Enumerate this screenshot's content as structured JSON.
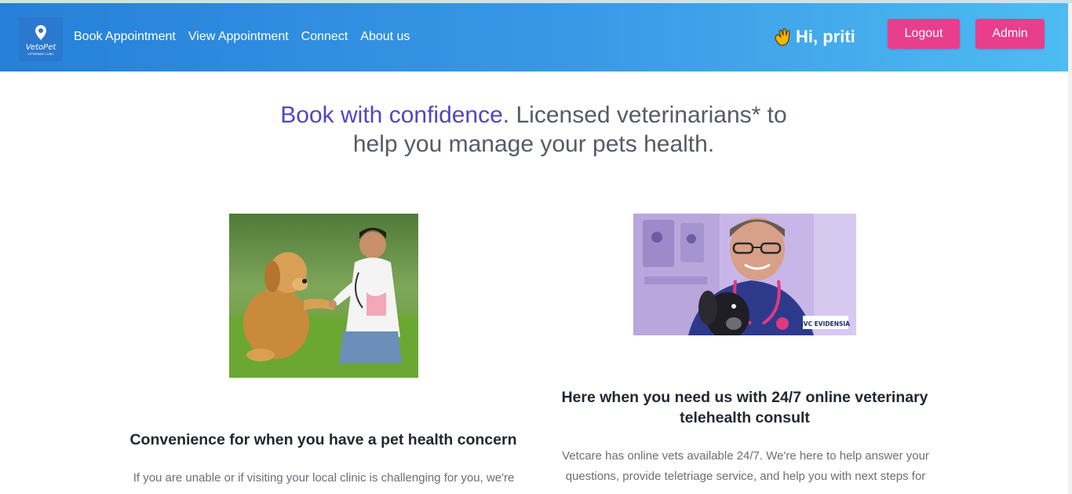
{
  "nav": {
    "logo_text": "VetoPet",
    "logo_subtext": "VETERINARY CLINIC",
    "links": [
      {
        "label": "Book Appointment"
      },
      {
        "label": "View Appointment"
      },
      {
        "label": "Connect"
      },
      {
        "label": "About us"
      }
    ],
    "greeting": "Hi, priti",
    "logout_label": "Logout",
    "admin_label": "Admin"
  },
  "hero": {
    "emphasis": "Book with confidence.",
    "rest": " Licensed veterinarians* to help you manage your pets health."
  },
  "cards": [
    {
      "title": "Convenience for when you have a pet health concern",
      "text": "If you are unable or if visiting your local clinic is challenging for you, we're"
    },
    {
      "title": "Here when you need us with 24/7 online veterinary telehealth consult",
      "text": "Vetcare has online vets available 24/7. We're here to help answer your questions, provide teletriage service, and help you with next steps for"
    }
  ],
  "images": {
    "vet_badge": "IVC EVIDENSIA"
  },
  "colors": {
    "nav_gradient_start": "#2680d9",
    "nav_gradient_end": "#4dbcf2",
    "button": "#e83e8c",
    "hero_emphasis": "#5046c4"
  }
}
